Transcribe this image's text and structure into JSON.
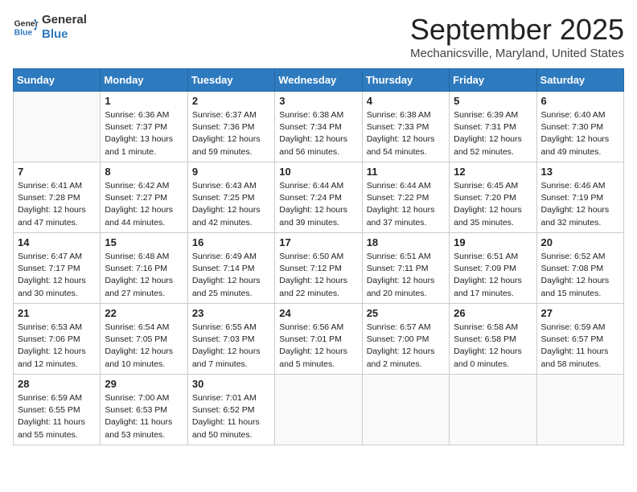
{
  "header": {
    "logo_line1": "General",
    "logo_line2": "Blue",
    "month": "September 2025",
    "location": "Mechanicsville, Maryland, United States"
  },
  "weekdays": [
    "Sunday",
    "Monday",
    "Tuesday",
    "Wednesday",
    "Thursday",
    "Friday",
    "Saturday"
  ],
  "weeks": [
    [
      {
        "day": "",
        "info": ""
      },
      {
        "day": "1",
        "info": "Sunrise: 6:36 AM\nSunset: 7:37 PM\nDaylight: 13 hours\nand 1 minute."
      },
      {
        "day": "2",
        "info": "Sunrise: 6:37 AM\nSunset: 7:36 PM\nDaylight: 12 hours\nand 59 minutes."
      },
      {
        "day": "3",
        "info": "Sunrise: 6:38 AM\nSunset: 7:34 PM\nDaylight: 12 hours\nand 56 minutes."
      },
      {
        "day": "4",
        "info": "Sunrise: 6:38 AM\nSunset: 7:33 PM\nDaylight: 12 hours\nand 54 minutes."
      },
      {
        "day": "5",
        "info": "Sunrise: 6:39 AM\nSunset: 7:31 PM\nDaylight: 12 hours\nand 52 minutes."
      },
      {
        "day": "6",
        "info": "Sunrise: 6:40 AM\nSunset: 7:30 PM\nDaylight: 12 hours\nand 49 minutes."
      }
    ],
    [
      {
        "day": "7",
        "info": "Sunrise: 6:41 AM\nSunset: 7:28 PM\nDaylight: 12 hours\nand 47 minutes."
      },
      {
        "day": "8",
        "info": "Sunrise: 6:42 AM\nSunset: 7:27 PM\nDaylight: 12 hours\nand 44 minutes."
      },
      {
        "day": "9",
        "info": "Sunrise: 6:43 AM\nSunset: 7:25 PM\nDaylight: 12 hours\nand 42 minutes."
      },
      {
        "day": "10",
        "info": "Sunrise: 6:44 AM\nSunset: 7:24 PM\nDaylight: 12 hours\nand 39 minutes."
      },
      {
        "day": "11",
        "info": "Sunrise: 6:44 AM\nSunset: 7:22 PM\nDaylight: 12 hours\nand 37 minutes."
      },
      {
        "day": "12",
        "info": "Sunrise: 6:45 AM\nSunset: 7:20 PM\nDaylight: 12 hours\nand 35 minutes."
      },
      {
        "day": "13",
        "info": "Sunrise: 6:46 AM\nSunset: 7:19 PM\nDaylight: 12 hours\nand 32 minutes."
      }
    ],
    [
      {
        "day": "14",
        "info": "Sunrise: 6:47 AM\nSunset: 7:17 PM\nDaylight: 12 hours\nand 30 minutes."
      },
      {
        "day": "15",
        "info": "Sunrise: 6:48 AM\nSunset: 7:16 PM\nDaylight: 12 hours\nand 27 minutes."
      },
      {
        "day": "16",
        "info": "Sunrise: 6:49 AM\nSunset: 7:14 PM\nDaylight: 12 hours\nand 25 minutes."
      },
      {
        "day": "17",
        "info": "Sunrise: 6:50 AM\nSunset: 7:12 PM\nDaylight: 12 hours\nand 22 minutes."
      },
      {
        "day": "18",
        "info": "Sunrise: 6:51 AM\nSunset: 7:11 PM\nDaylight: 12 hours\nand 20 minutes."
      },
      {
        "day": "19",
        "info": "Sunrise: 6:51 AM\nSunset: 7:09 PM\nDaylight: 12 hours\nand 17 minutes."
      },
      {
        "day": "20",
        "info": "Sunrise: 6:52 AM\nSunset: 7:08 PM\nDaylight: 12 hours\nand 15 minutes."
      }
    ],
    [
      {
        "day": "21",
        "info": "Sunrise: 6:53 AM\nSunset: 7:06 PM\nDaylight: 12 hours\nand 12 minutes."
      },
      {
        "day": "22",
        "info": "Sunrise: 6:54 AM\nSunset: 7:05 PM\nDaylight: 12 hours\nand 10 minutes."
      },
      {
        "day": "23",
        "info": "Sunrise: 6:55 AM\nSunset: 7:03 PM\nDaylight: 12 hours\nand 7 minutes."
      },
      {
        "day": "24",
        "info": "Sunrise: 6:56 AM\nSunset: 7:01 PM\nDaylight: 12 hours\nand 5 minutes."
      },
      {
        "day": "25",
        "info": "Sunrise: 6:57 AM\nSunset: 7:00 PM\nDaylight: 12 hours\nand 2 minutes."
      },
      {
        "day": "26",
        "info": "Sunrise: 6:58 AM\nSunset: 6:58 PM\nDaylight: 12 hours\nand 0 minutes."
      },
      {
        "day": "27",
        "info": "Sunrise: 6:59 AM\nSunset: 6:57 PM\nDaylight: 11 hours\nand 58 minutes."
      }
    ],
    [
      {
        "day": "28",
        "info": "Sunrise: 6:59 AM\nSunset: 6:55 PM\nDaylight: 11 hours\nand 55 minutes."
      },
      {
        "day": "29",
        "info": "Sunrise: 7:00 AM\nSunset: 6:53 PM\nDaylight: 11 hours\nand 53 minutes."
      },
      {
        "day": "30",
        "info": "Sunrise: 7:01 AM\nSunset: 6:52 PM\nDaylight: 11 hours\nand 50 minutes."
      },
      {
        "day": "",
        "info": ""
      },
      {
        "day": "",
        "info": ""
      },
      {
        "day": "",
        "info": ""
      },
      {
        "day": "",
        "info": ""
      }
    ]
  ]
}
